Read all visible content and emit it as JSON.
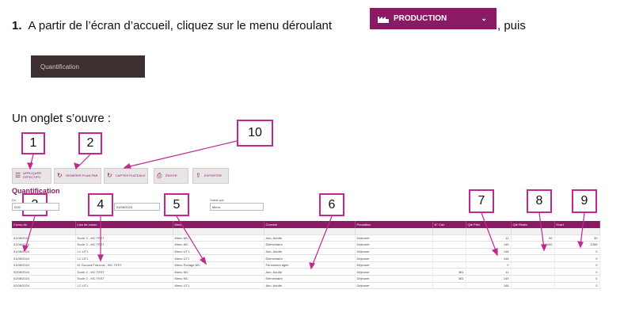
{
  "instruction": {
    "number": "1.",
    "text": "A partir de l’écran d’accueil, cliquez sur le menu déroulant",
    "after": ", puis",
    "production_button": {
      "label": "PRODUCTION",
      "icon": "factory-icon",
      "chevron": "⌄",
      "color": "#8a1a63"
    },
    "quantification_button": {
      "label": "Quantification",
      "color": "#3c2f30"
    }
  },
  "onglet_text": "Un onglet s’ouvre :",
  "callouts": [
    "1",
    "2",
    "10",
    "3",
    "4",
    "5",
    "6",
    "7",
    "8",
    "9"
  ],
  "toolbar": [
    {
      "label": "APPLIQUER EFFECTIFS",
      "icon": "list-icon"
    },
    {
      "label": "GENERER PLAN PAR",
      "icon": "refresh-icon"
    },
    {
      "label": "CAPTES PLATEAUX",
      "icon": "refresh-icon"
    },
    {
      "label": "ÉDITER",
      "icon": "print-icon"
    },
    {
      "label": "EXPORTER",
      "icon": "export-icon"
    }
  ],
  "screen": {
    "title": "Quantification",
    "filters": {
      "du_label": "Du",
      "du_value": "01/0",
      "au_value": "01/08/2024",
      "saisie_label": "Saisie par",
      "saisie_value": "Menu"
    },
    "columns": [
      "Conso du",
      "Lieu de conso",
      "Menu",
      "Convive",
      "Prestation",
      "N° Cde",
      "Qté Prév",
      "Qté Réalis",
      "Ecart"
    ],
    "rows": [
      [
        "01/08/2024",
        "Ecole 2 - MC TEST",
        "Menu MC",
        "Ado, Adulte",
        "Déjeuner",
        "",
        "11",
        "50",
        "39"
      ],
      [
        "01/08/2024",
        "Ecole 2 - MC TEST",
        "Menu MC",
        "Elémentaire",
        "Déjeuner",
        "",
        "145",
        "1200",
        "1055"
      ],
      [
        "01/08/2024",
        "LC UT1",
        "Menu UT1",
        "Ado, Adulte",
        "Déjeuner",
        "",
        "148",
        "",
        "0"
      ],
      [
        "01/08/2024",
        "LC UT1",
        "Menu UT1",
        "Elémentaire",
        "Déjeuner",
        "",
        "148",
        "",
        "0"
      ],
      [
        "01/08/2024",
        "M. Durand Francois - MC TEST",
        "Menu Portage MC",
        "Personnes âgée",
        "Déjeuner",
        "",
        "0",
        "",
        "0"
      ],
      [
        "02/08/2024",
        "Ecole 2 - MC TEST",
        "Menu MC",
        "Ado, Adulte",
        "Déjeuner",
        "381",
        "11",
        "",
        "0"
      ],
      [
        "02/08/2024",
        "Ecole 2 - MC TEST",
        "Menu MC",
        "Elémentaire",
        "Déjeuner",
        "381",
        "145",
        "",
        "0"
      ],
      [
        "02/08/2024",
        "LC UT1",
        "Menu UT1",
        "Ado, Adulte",
        "Déjeuner",
        "",
        "148",
        "",
        "0"
      ]
    ]
  }
}
